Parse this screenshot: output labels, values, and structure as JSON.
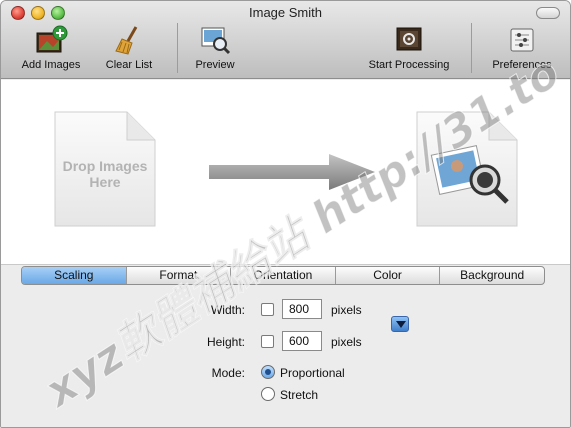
{
  "window": {
    "title": "Image Smith"
  },
  "toolbar": {
    "add_images": "Add Images",
    "clear_list": "Clear List",
    "preview": "Preview",
    "start_processing": "Start Processing",
    "preferences": "Preferences"
  },
  "drop_area": {
    "drop_label": "Drop Images Here"
  },
  "tabs": [
    "Scaling",
    "Format",
    "Orientation",
    "Color",
    "Background"
  ],
  "scaling": {
    "width_label": "Width:",
    "width_value": "800",
    "width_unit": "pixels",
    "height_label": "Height:",
    "height_value": "600",
    "height_unit": "pixels",
    "mode_label": "Mode:",
    "mode_proportional": "Proportional",
    "mode_stretch": "Stretch"
  },
  "watermark": {
    "text": "xyz軟體補給站 http://31.to"
  },
  "colors": {
    "accent": "#6aa8e6",
    "active_tab": "#a8d0f6"
  }
}
